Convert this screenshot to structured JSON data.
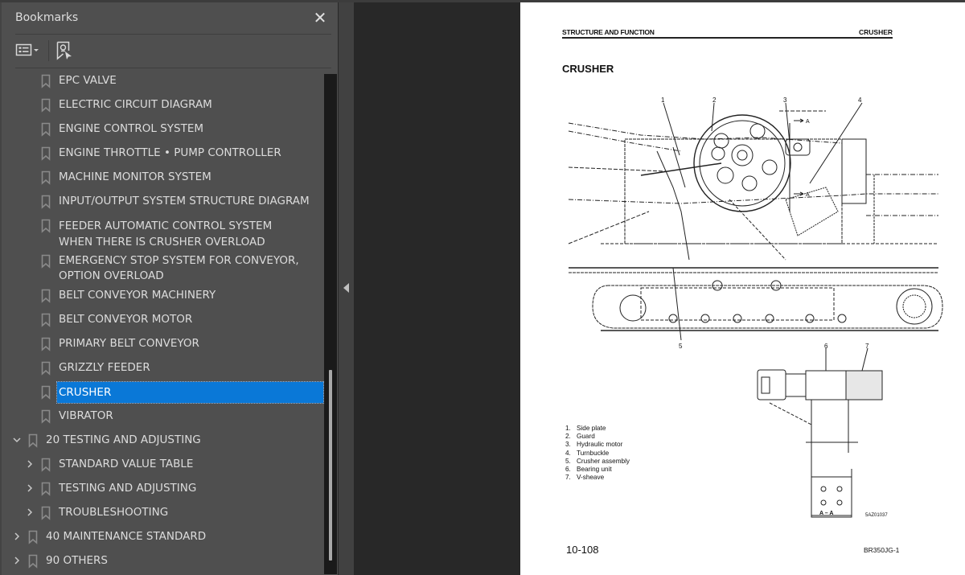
{
  "sidebar": {
    "title": "Bookmarks",
    "close_icon": "close-icon",
    "toolbar": {
      "options_icon": "list-options-icon",
      "dropdown_icon": "caret-down-icon",
      "find_bookmark_icon": "bookmark-search-icon"
    },
    "items": [
      {
        "label": "EPC VALVE",
        "level": 2,
        "expander": "none"
      },
      {
        "label": "ELECTRIC CIRCUIT DIAGRAM",
        "level": 2,
        "expander": "none"
      },
      {
        "label": "ENGINE CONTROL SYSTEM",
        "level": 2,
        "expander": "none"
      },
      {
        "label": "ENGINE THROTTLE • PUMP CONTROLLER",
        "level": 2,
        "expander": "none"
      },
      {
        "label": "MACHINE MONITOR SYSTEM",
        "level": 2,
        "expander": "none"
      },
      {
        "label": "INPUT/OUTPUT SYSTEM STRUCTURE DIAGRAM",
        "level": 2,
        "expander": "none"
      },
      {
        "label": "FEEDER AUTOMATIC CONTROL SYSTEM WHEN THERE IS CRUSHER OVERLOAD",
        "level": 2,
        "expander": "none"
      },
      {
        "label": "EMERGENCY STOP SYSTEM FOR CONVEYOR, OPTION OVERLOAD",
        "level": 2,
        "expander": "none"
      },
      {
        "label": "BELT CONVEYOR MACHINERY",
        "level": 2,
        "expander": "none"
      },
      {
        "label": "BELT CONVEYOR MOTOR",
        "level": 2,
        "expander": "none"
      },
      {
        "label": "PRIMARY BELT CONVEYOR",
        "level": 2,
        "expander": "none"
      },
      {
        "label": "GRIZZLY FEEDER",
        "level": 2,
        "expander": "none"
      },
      {
        "label": "CRUSHER",
        "level": 2,
        "expander": "none",
        "selected": true
      },
      {
        "label": "VIBRATOR",
        "level": 2,
        "expander": "none"
      },
      {
        "label": "20 TESTING AND ADJUSTING",
        "level": 1,
        "expander": "expanded"
      },
      {
        "label": "STANDARD VALUE TABLE",
        "level": 2,
        "expander": "collapsed"
      },
      {
        "label": "TESTING AND ADJUSTING",
        "level": 2,
        "expander": "collapsed"
      },
      {
        "label": "TROUBLESHOOTING",
        "level": 2,
        "expander": "collapsed"
      },
      {
        "label": "40 MAINTENANCE STANDARD",
        "level": 1,
        "expander": "collapsed"
      },
      {
        "label": "90 OTHERS",
        "level": 1,
        "expander": "collapsed"
      }
    ],
    "collapse_panel_icon": "triangle-left-icon"
  },
  "document": {
    "header_left": "STRUCTURE AND FUNCTION",
    "header_right": "CRUSHER",
    "title": "CRUSHER",
    "callouts": [
      "1",
      "2",
      "3",
      "4",
      "5",
      "6",
      "7"
    ],
    "section_marker": "A",
    "section_label": "A – A",
    "legend": [
      {
        "n": "1.",
        "text": "Side plate"
      },
      {
        "n": "2.",
        "text": "Guard"
      },
      {
        "n": "3.",
        "text": "Hydraulic motor"
      },
      {
        "n": "4.",
        "text": "Turnbuckle"
      },
      {
        "n": "5.",
        "text": "Crusher assembly"
      },
      {
        "n": "6.",
        "text": "Bearing unit"
      },
      {
        "n": "7.",
        "text": "V-sheave"
      }
    ],
    "figure_code": "5AZ01037",
    "page_number": "10-108",
    "model": "BR350JG-1"
  }
}
